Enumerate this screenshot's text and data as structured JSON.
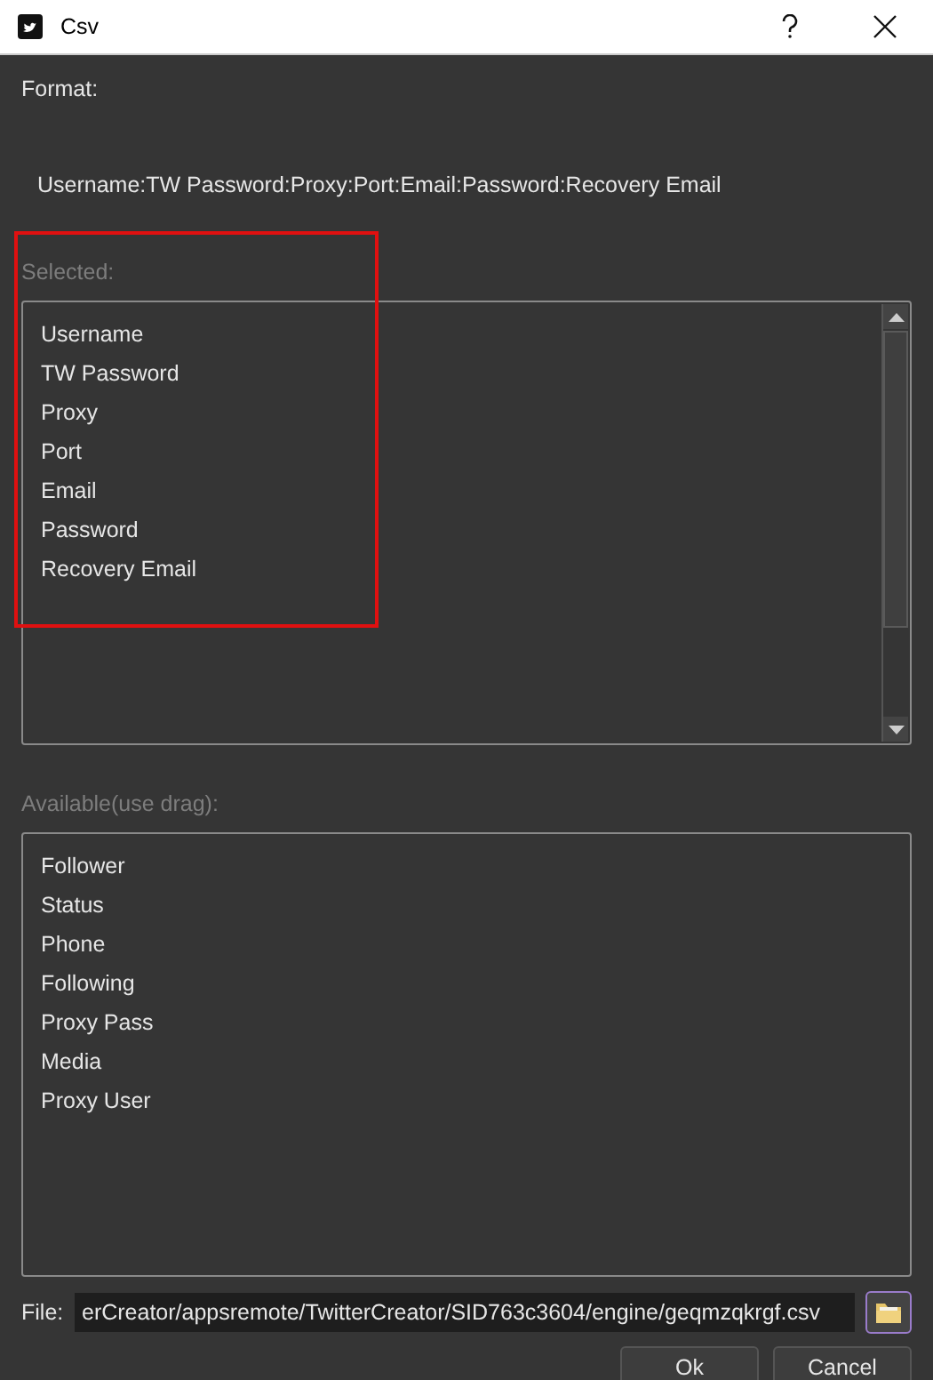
{
  "window": {
    "title": "Csv"
  },
  "format": {
    "label": "Format:",
    "value": "Username:TW Password:Proxy:Port:Email:Password:Recovery Email"
  },
  "selected": {
    "label": "Selected:",
    "items": [
      "Username",
      "TW Password",
      "Proxy",
      "Port",
      "Email",
      "Password",
      "Recovery Email"
    ]
  },
  "available": {
    "label": "Available(use drag):",
    "items": [
      "Follower",
      "Status",
      "Phone",
      "Following",
      "Proxy Pass",
      "Media",
      "Proxy User"
    ]
  },
  "file": {
    "label": "File:",
    "value": "erCreator/appsremote/TwitterCreator/SID763c3604/engine/geqmzqkrgf.csv"
  },
  "buttons": [
    "Ok",
    "Cancel"
  ]
}
